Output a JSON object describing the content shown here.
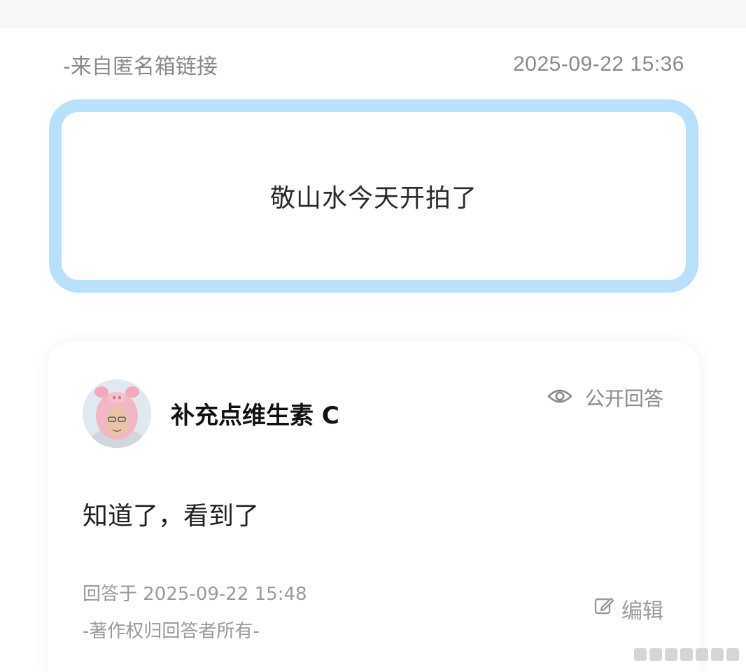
{
  "question": {
    "source": "-来自匿名箱链接",
    "timestamp": "2025-09-22 15:36",
    "text": "敬山水今天开拍了"
  },
  "answer": {
    "user_name": "补充点维生素 C",
    "avatar_icon": "avatar-person-pig-hat",
    "visibility_icon": "eye-icon",
    "visibility_label": "公开回答",
    "text": "知道了，看到了",
    "answered_at": "回答于 2025-09-22 15:48",
    "copyright": "-著作权归回答者所有-",
    "edit_icon": "edit-icon",
    "edit_label": "编辑"
  },
  "colors": {
    "card_border": "#b9e0fb",
    "muted_text": "#8a8a8a",
    "background": "#ffffff"
  }
}
